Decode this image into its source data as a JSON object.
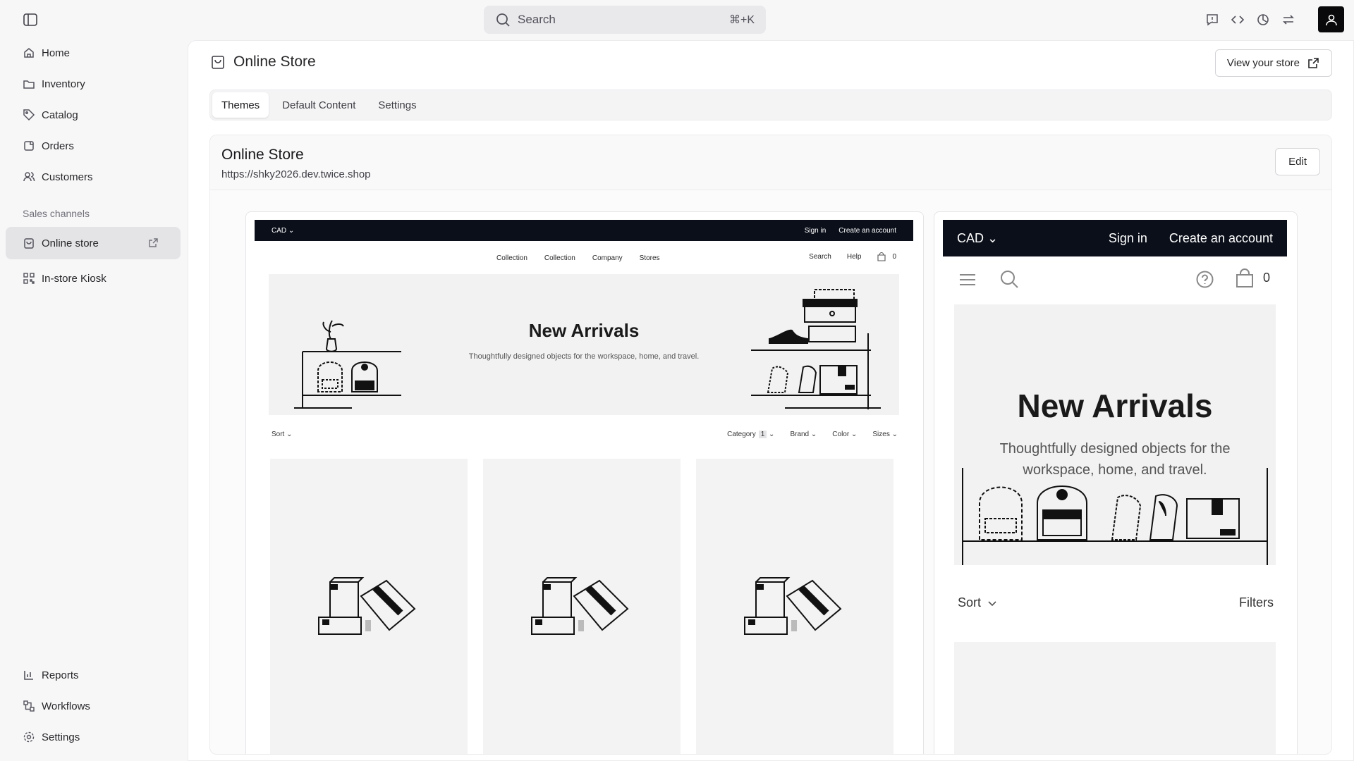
{
  "sidebar": {
    "items": [
      {
        "label": "Home"
      },
      {
        "label": "Inventory"
      },
      {
        "label": "Catalog"
      },
      {
        "label": "Orders"
      },
      {
        "label": "Customers"
      }
    ],
    "section_label": "Sales channels",
    "channels": [
      {
        "label": "Online store"
      },
      {
        "label": "In-store Kiosk"
      }
    ],
    "bottom": [
      {
        "label": "Reports"
      },
      {
        "label": "Workflows"
      },
      {
        "label": "Settings"
      }
    ]
  },
  "topbar": {
    "search_placeholder": "Search",
    "search_shortcut": "⌘+K"
  },
  "page": {
    "title": "Online Store",
    "view_store_label": "View your store",
    "tabs": [
      {
        "label": "Themes"
      },
      {
        "label": "Default Content"
      },
      {
        "label": "Settings"
      }
    ],
    "card_title": "Online Store",
    "card_url": "https://shky2026.dev.twice.shop",
    "edit_label": "Edit"
  },
  "desktop_preview": {
    "currency": "CAD",
    "sign_in": "Sign in",
    "create_account": "Create an account",
    "nav_links": [
      "Collection",
      "Collection",
      "Company",
      "Stores"
    ],
    "search": "Search",
    "help": "Help",
    "cart_count": "0",
    "hero_title": "New Arrivals",
    "hero_sub": "Thoughtfully designed objects for the workspace, home, and travel.",
    "sort": "Sort",
    "filters": {
      "category": "Category",
      "category_count": "1",
      "brand": "Brand",
      "color": "Color",
      "sizes": "Sizes"
    }
  },
  "mobile_preview": {
    "currency": "CAD",
    "sign_in": "Sign in",
    "create_account": "Create an account",
    "cart_count": "0",
    "hero_title": "New Arrivals",
    "hero_sub": "Thoughtfully designed objects for the workspace, home, and travel.",
    "sort": "Sort",
    "filters": "Filters"
  }
}
